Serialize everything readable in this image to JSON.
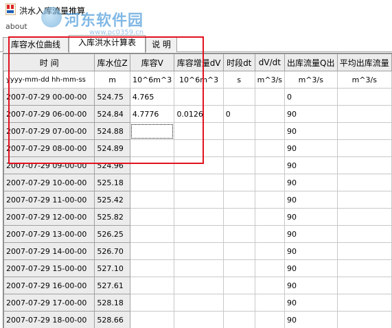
{
  "window": {
    "title": "洪水入库流量推算"
  },
  "watermark": {
    "name": "河东软件园",
    "url": "www.pc0359.cn"
  },
  "menu": {
    "items": [
      {
        "label": "about"
      }
    ]
  },
  "tabs": [
    {
      "label": "库容水位曲线",
      "active": false
    },
    {
      "label": "入库洪水计算表",
      "active": true
    },
    {
      "label": "说 明",
      "active": false
    }
  ],
  "grid": {
    "headers": [
      "时 间",
      "库水位Z",
      "库容V",
      "库容增量dV",
      "时段dt",
      "dV/dt",
      "出库流量Q出",
      "平均出库流量"
    ],
    "units": [
      "yyyy-mm-dd hh-mm-ss",
      "m",
      "10^6m^3",
      "10^6m^3",
      "s",
      "m^3/s",
      "m^3/s",
      "m^3/s"
    ],
    "rows": [
      [
        "2007-07-29 00-00-00",
        "524.75",
        "4.765",
        "",
        "",
        "",
        "0",
        ""
      ],
      [
        "2007-07-29 06-00-00",
        "524.84",
        "4.7776",
        "0.0126",
        "0",
        "",
        "90",
        ""
      ],
      [
        "2007-07-29 07-00-00",
        "524.88",
        "",
        "",
        "",
        "",
        "90",
        ""
      ],
      [
        "2007-07-29 08-00-00",
        "524.89",
        "",
        "",
        "",
        "",
        "90",
        ""
      ],
      [
        "2007-07-29 09-00-00",
        "524.96",
        "",
        "",
        "",
        "",
        "90",
        ""
      ],
      [
        "2007-07-29 10-00-00",
        "525.18",
        "",
        "",
        "",
        "",
        "90",
        ""
      ],
      [
        "2007-07-29 11-00-00",
        "525.42",
        "",
        "",
        "",
        "",
        "90",
        ""
      ],
      [
        "2007-07-29 12-00-00",
        "525.82",
        "",
        "",
        "",
        "",
        "90",
        ""
      ],
      [
        "2007-07-29 13-00-00",
        "526.25",
        "",
        "",
        "",
        "",
        "90",
        ""
      ],
      [
        "2007-07-29 14-00-00",
        "526.70",
        "",
        "",
        "",
        "",
        "90",
        ""
      ],
      [
        "2007-07-29 15-00-00",
        "527.10",
        "",
        "",
        "",
        "",
        "90",
        ""
      ],
      [
        "2007-07-29 16-00-00",
        "527.61",
        "",
        "",
        "",
        "",
        "90",
        ""
      ],
      [
        "2007-07-29 17-00-00",
        "528.18",
        "",
        "",
        "",
        "",
        "90",
        ""
      ],
      [
        "2007-07-29 18-00-00",
        "528.66",
        "",
        "",
        "",
        "",
        "90",
        ""
      ]
    ],
    "selected_cell": {
      "row": 2,
      "col": 2
    }
  },
  "colors": {
    "highlight_box": "#e3101e",
    "watermark": "#1b7fd0"
  }
}
